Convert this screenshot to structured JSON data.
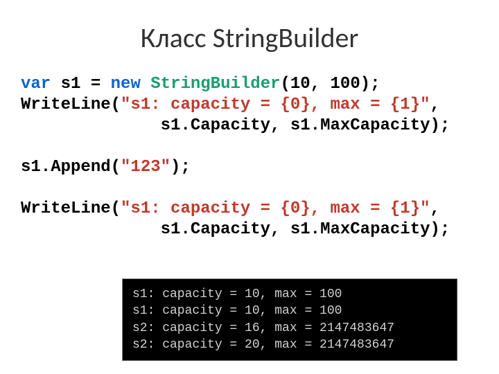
{
  "title": "Класс StringBuilder",
  "code": {
    "l1": {
      "var": "var",
      "rest1": " s1 = ",
      "new": "new",
      "rest2": " ",
      "type": "StringBuilder",
      "rest3": "(10, 100);"
    },
    "l2": {
      "a": "WriteLine(",
      "s": "\"s1: capacity = {0}, max = {1}\"",
      "b": ","
    },
    "l3": "              s1.Capacity, s1.MaxCapacity);",
    "l4": "",
    "l5": {
      "a": "s1.Append(",
      "s": "\"123\"",
      "b": ");"
    },
    "l6": "",
    "l7": {
      "a": "WriteLine(",
      "s": "\"s1: capacity = {0}, max = {1}\"",
      "b": ","
    },
    "l8": "              s1.Capacity, s1.MaxCapacity);"
  },
  "console": {
    "l1": "s1: capacity = 10, max = 100",
    "l2": "s1: capacity = 10, max = 100",
    "l3": "s2: capacity = 16, max = 2147483647",
    "l4": "s2: capacity = 20, max = 2147483647"
  }
}
